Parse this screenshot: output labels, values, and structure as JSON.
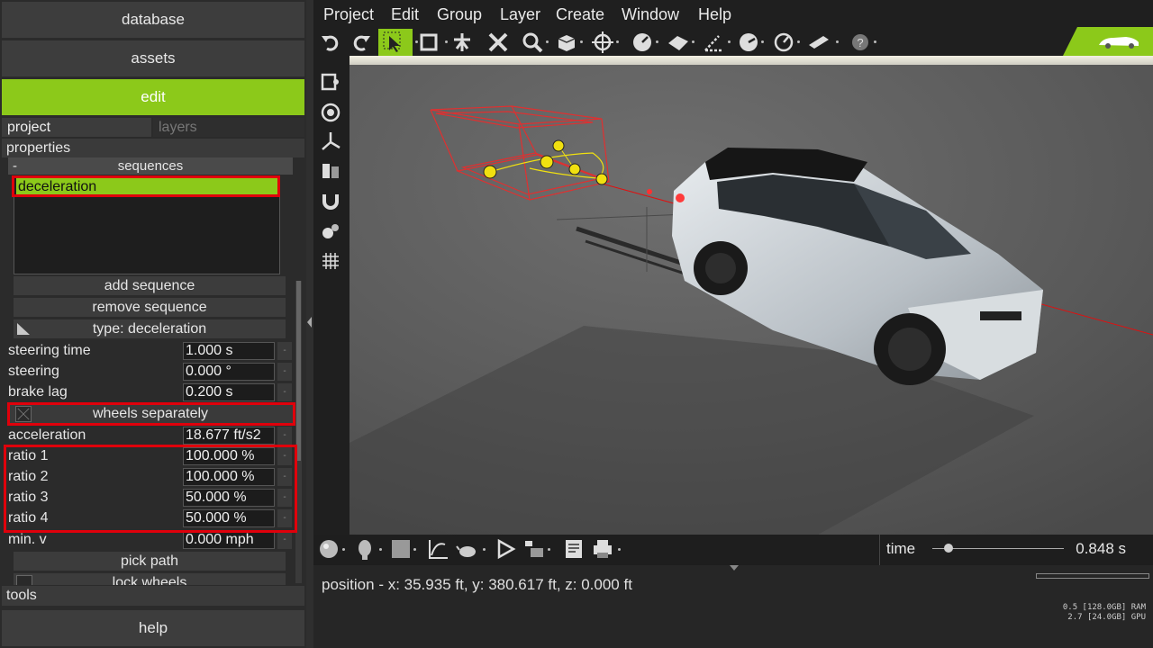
{
  "left_panel": {
    "nav": {
      "database": "database",
      "assets": "assets",
      "edit": "edit",
      "help": "help"
    },
    "subtabs": {
      "project": "project",
      "layers": "layers"
    },
    "properties_label": "properties",
    "sequences": {
      "collapse_symbol": "-",
      "title": "sequences",
      "items": [
        "deceleration"
      ],
      "add": "add sequence",
      "remove": "remove sequence",
      "type": "type: deceleration"
    },
    "props": {
      "steering_time": {
        "label": "steering time",
        "value": "1.000 s"
      },
      "steering": {
        "label": "steering",
        "value": "0.000 °"
      },
      "brake_lag": {
        "label": "brake lag",
        "value": "0.200 s"
      },
      "wheels_separately": {
        "label": "wheels separately",
        "checked": false
      },
      "acceleration": {
        "label": "acceleration",
        "value": "18.677 ft/s2"
      },
      "ratio1": {
        "label": "ratio 1",
        "value": "100.000 %"
      },
      "ratio2": {
        "label": "ratio 2",
        "value": "100.000 %"
      },
      "ratio3": {
        "label": "ratio 3",
        "value": "50.000 %"
      },
      "ratio4": {
        "label": "ratio 4",
        "value": "50.000 %"
      },
      "min_v": {
        "label": "min. v",
        "value": "0.000 mph"
      }
    },
    "pick_path": "pick path",
    "lock_wheels": "lock wheels",
    "tools_label": "tools"
  },
  "menu": [
    "Project",
    "Edit",
    "Group",
    "Layer",
    "Create",
    "Window",
    "Help"
  ],
  "toolbar_icons": [
    "undo-icon",
    "redo-icon",
    "select-arrow-icon",
    "rectangle-select-icon",
    "move-pivot-icon",
    "delete-x-icon",
    "zoom-icon",
    "cube-icon",
    "orbit-crosshair-icon",
    "measure-dial-icon",
    "plane-icon",
    "angle-icon",
    "dial-icon",
    "gauge-icon",
    "ruler-icon",
    "help-icon"
  ],
  "status": {
    "time_label": "time",
    "time_value": "0.848 s",
    "time_fraction": 0.12,
    "position": "position - x: 35.935 ft, y: 380.617 ft, z: 0.000 ft",
    "ram": "0.5 [128.0GB] RAM",
    "gpu": "2.7 [24.0GB] GPU"
  },
  "colors": {
    "accent": "#8cc91a",
    "highlight_box": "#e0000b",
    "panel": "#2b2b2b"
  }
}
